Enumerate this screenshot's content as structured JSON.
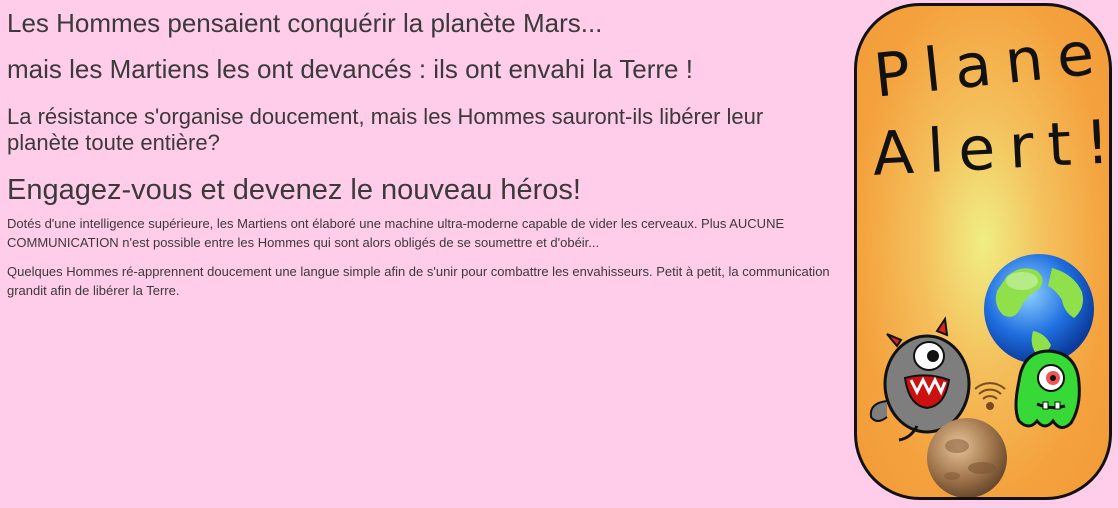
{
  "intro": {
    "line1": "Les Hommes pensaient conquérir la planète Mars...",
    "line2": "mais les Martiens les ont devancés : ils ont envahi la Terre !",
    "line3": "La résistance s'organise doucement, mais les Hommes sauront-ils libérer leur planète toute entière?",
    "line4": "Engagez-vous et devenez le nouveau héros!"
  },
  "paragraphs": {
    "p1": "Dotés d'une intelligence supérieure, les Martiens ont élaboré une machine ultra-moderne capable de vider les cerveaux. Plus AUCUNE COMMUNICATION n'est possible entre les Hommes qui sont alors obligés de se soumettre et d'obéir...",
    "p2": "Quelques Hommes ré-apprennent doucement une langue simple afin de s'unir pour  combattre les envahisseurs. Petit à petit, la communication grandit afin de libérer la Terre."
  },
  "logo": {
    "word1": "Planet",
    "word2": "Alert!"
  },
  "colors": {
    "page_background": "#ffccea",
    "text": "#3a3a3a",
    "banner_orange": "#f29a36",
    "banner_center": "#f0ee84",
    "banner_border": "#111111"
  },
  "icons": [
    "earth-icon",
    "gray-martian-icon",
    "green-martian-icon",
    "mars-planet-icon",
    "signal-waves-icon"
  ]
}
